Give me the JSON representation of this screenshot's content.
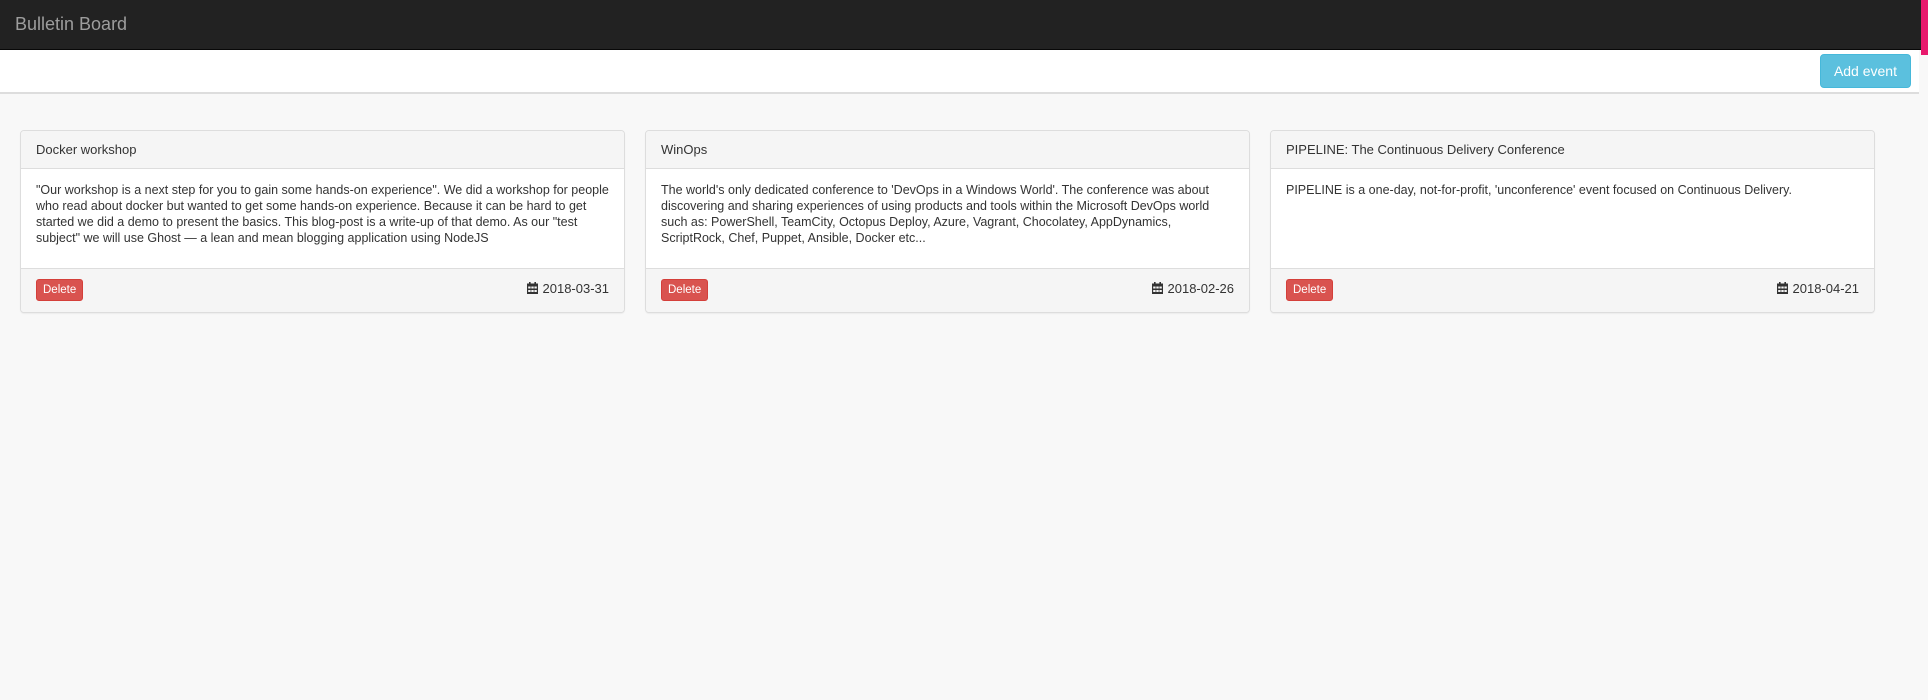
{
  "app": {
    "title": "Bulletin Board"
  },
  "toolbar": {
    "add_label": "Add event"
  },
  "events": [
    {
      "title": "Docker workshop",
      "description": "\"Our workshop is a next step for you to gain some hands-on experience\". We did a workshop for people who read about docker but wanted to get some hands-on experience. Because it can be hard to get started we did a demo to present the basics. This blog-post is a write-up of that demo. As our \"test subject\" we will use Ghost — a lean and mean blogging application using NodeJS",
      "delete_label": "Delete",
      "date": "2018-03-31"
    },
    {
      "title": "WinOps",
      "description": "The world's only dedicated conference to 'DevOps in a Windows World'. The conference was about discovering and sharing experiences of using products and tools within the Microsoft DevOps world such as: PowerShell, TeamCity, Octopus Deploy, Azure, Vagrant, Chocolatey, AppDynamics, ScriptRock, Chef, Puppet, Ansible, Docker etc...",
      "delete_label": "Delete",
      "date": "2018-02-26"
    },
    {
      "title": "PIPELINE: The Continuous Delivery Conference",
      "description": "PIPELINE is a one-day, not-for-profit, 'unconference' event focused on Continuous Delivery.",
      "delete_label": "Delete",
      "date": "2018-04-21"
    }
  ],
  "colors": {
    "navbar": "#222222",
    "info_button": "#5bc0de",
    "danger_button": "#d9534f",
    "accent": "#e8196d"
  },
  "icons": {
    "date": "calendar-icon"
  }
}
